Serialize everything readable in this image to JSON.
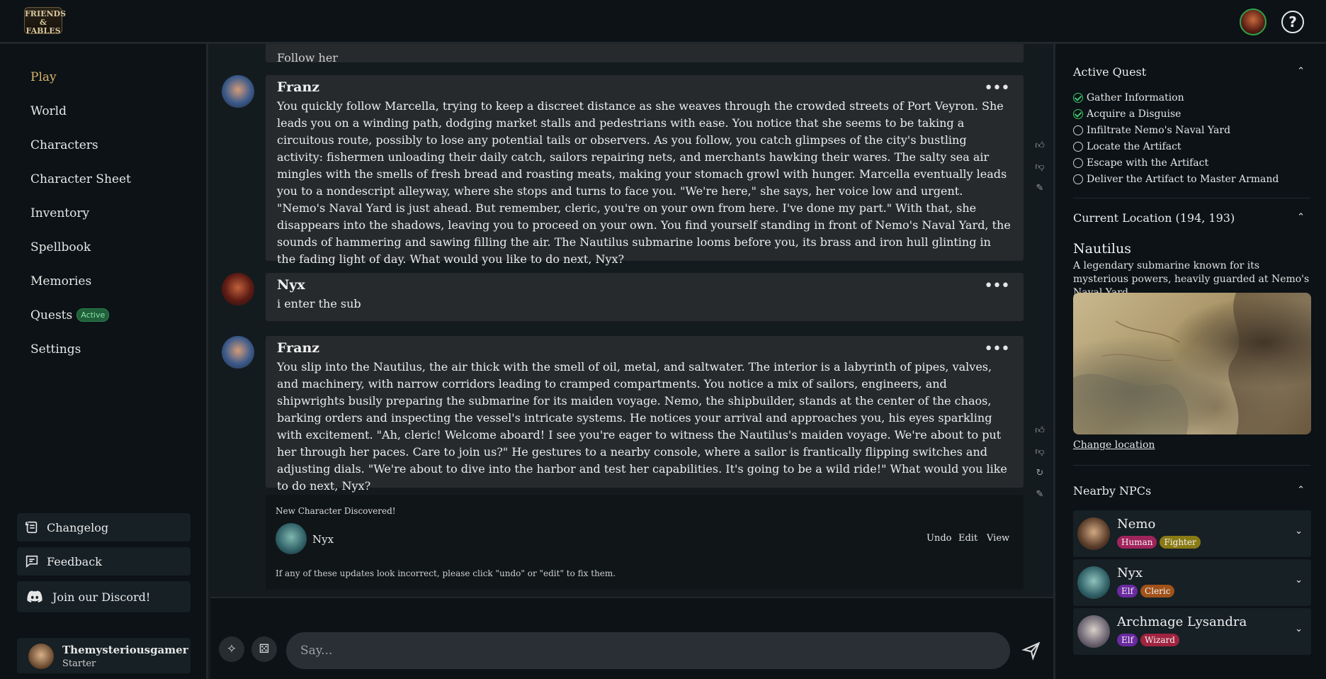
{
  "header": {
    "logo_text": "FRIENDS & FABLES",
    "help_label": "?"
  },
  "sidebar": {
    "nav": [
      {
        "label": "Play"
      },
      {
        "label": "World"
      },
      {
        "label": "Characters"
      },
      {
        "label": "Character Sheet"
      },
      {
        "label": "Inventory"
      },
      {
        "label": "Spellbook"
      },
      {
        "label": "Memories"
      },
      {
        "label": "Quests",
        "badge": "Active"
      },
      {
        "label": "Settings"
      }
    ],
    "changelog": "Changelog",
    "feedback": "Feedback",
    "discord": "Join our Discord!",
    "user": {
      "name": "Themysteriousgamer",
      "tier": "Starter"
    }
  },
  "chat": {
    "prev_fragment": "Follow her",
    "messages": [
      {
        "name": "Franz",
        "text": "You quickly follow Marcella, trying to keep a discreet distance as she weaves through the crowded streets of Port Veyron. She leads you on a winding path, dodging market stalls and pedestrians with ease. You notice that she seems to be taking a circuitous route, possibly to lose any potential tails or observers. As you follow, you catch glimpses of the city's bustling activity: fishermen unloading their daily catch, sailors repairing nets, and merchants hawking their wares. The salty sea air mingles with the smells of fresh bread and roasting meats, making your stomach growl with hunger. Marcella eventually leads you to a nondescript alleyway, where she stops and turns to face you. \"We're here,\" she says, her voice low and urgent. \"Nemo's Naval Yard is just ahead. But remember, cleric, you're on your own from here. I've done my part.\" With that, she disappears into the shadows, leaving you to proceed on your own. You find yourself standing in front of Nemo's Naval Yard, the sounds of hammering and sawing filling the air. The Nautilus submarine looms before you, its brass and iron hull glinting in the fading light of day. What would you like to do next, Nyx?"
      },
      {
        "name": "Nyx",
        "text": "i enter the sub"
      },
      {
        "name": "Franz",
        "text": "You slip into the Nautilus, the air thick with the smell of oil, metal, and saltwater. The interior is a labyrinth of pipes, valves, and machinery, with narrow corridors leading to cramped compartments. You notice a mix of sailors, engineers, and shipwrights busily preparing the submarine for its maiden voyage. Nemo, the shipbuilder, stands at the center of the chaos, barking orders and inspecting the vessel's intricate systems. He notices your arrival and approaches you, his eyes sparkling with excitement. \"Ah, cleric! Welcome aboard! I see you're eager to witness the Nautilus's maiden voyage. We're about to put her through her paces. Care to join us?\" He gestures to a nearby console, where a sailor is frantically flipping switches and adjusting dials. \"We're about to dive into the harbor and test her capabilities. It's going to be a wild ride!\" What would you like to do next, Nyx?"
      }
    ],
    "discovery": {
      "title": "New Character Discovered!",
      "name": "Nyx",
      "undo": "Undo",
      "edit": "Edit",
      "view": "View",
      "note": "If any of these updates look incorrect, please click \"undo\" or \"edit\" to fix them."
    },
    "composer": {
      "placeholder": "Say..."
    }
  },
  "panel": {
    "quest": {
      "title": "Active Quest",
      "steps": [
        {
          "label": "Gather Information",
          "done": true
        },
        {
          "label": "Acquire a Disguise",
          "done": true
        },
        {
          "label": "Infiltrate Nemo's Naval Yard",
          "done": false
        },
        {
          "label": "Locate the Artifact",
          "done": false
        },
        {
          "label": "Escape with the Artifact",
          "done": false
        },
        {
          "label": "Deliver the Artifact to Master Armand",
          "done": false
        }
      ]
    },
    "location": {
      "title": "Current Location (194, 193)",
      "name": "Nautilus",
      "description": "A legendary submarine known for its mysterious powers, heavily guarded at Nemo's Naval Yard.",
      "change": "Change location"
    },
    "npcs": {
      "title": "Nearby NPCs",
      "list": [
        {
          "name": "Nemo",
          "tags": [
            {
              "label": "Human",
              "color": "#a0245c"
            },
            {
              "label": "Fighter",
              "color": "#8a7a14"
            }
          ]
        },
        {
          "name": "Nyx",
          "tags": [
            {
              "label": "Elf",
              "color": "#6a2aa0"
            },
            {
              "label": "Cleric",
              "color": "#a0521a"
            }
          ]
        },
        {
          "name": "Archmage Lysandra",
          "tags": [
            {
              "label": "Elf",
              "color": "#6a2aa0"
            },
            {
              "label": "Wizard",
              "color": "#a02440"
            }
          ]
        }
      ]
    }
  }
}
